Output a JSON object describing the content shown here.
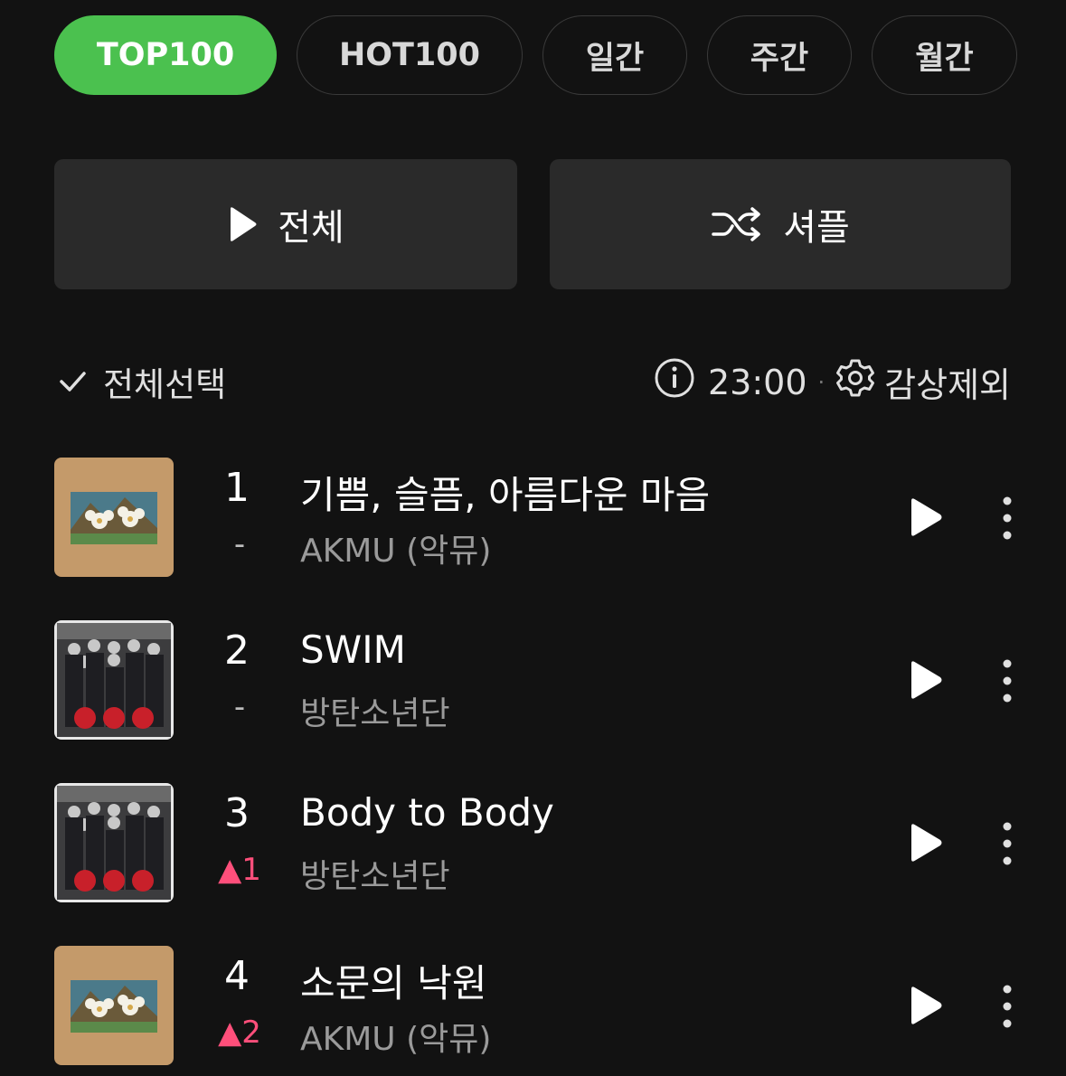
{
  "tabs": [
    {
      "label": "TOP100",
      "active": true
    },
    {
      "label": "HOT100",
      "active": false
    },
    {
      "label": "일간",
      "active": false
    },
    {
      "label": "주간",
      "active": false
    },
    {
      "label": "월간",
      "active": false
    }
  ],
  "actions": {
    "play_all": "전체",
    "shuffle": "셔플"
  },
  "toolbar": {
    "select_all": "전체선택",
    "time": "23:00",
    "separator": "·",
    "exclude": "감상제외"
  },
  "songs": [
    {
      "rank": "1",
      "change": "-",
      "change_dir": "same",
      "title": "기쁨, 슬픔, 아름다운 마음",
      "artist": "AKMU (악뮤)",
      "art": "akmu-album"
    },
    {
      "rank": "2",
      "change": "-",
      "change_dir": "same",
      "title": "SWIM",
      "artist": "방탄소년단",
      "art": "bts-album"
    },
    {
      "rank": "3",
      "change": "▲1",
      "change_dir": "up",
      "title": "Body to Body",
      "artist": "방탄소년단",
      "art": "bts-album"
    },
    {
      "rank": "4",
      "change": "▲2",
      "change_dir": "up",
      "title": "소문의 낙원",
      "artist": "AKMU (악뮤)",
      "art": "akmu-album"
    }
  ],
  "colors": {
    "accent": "#4bc14f",
    "up": "#ff4f7b",
    "background": "#121212",
    "button": "#2a2a2a"
  }
}
